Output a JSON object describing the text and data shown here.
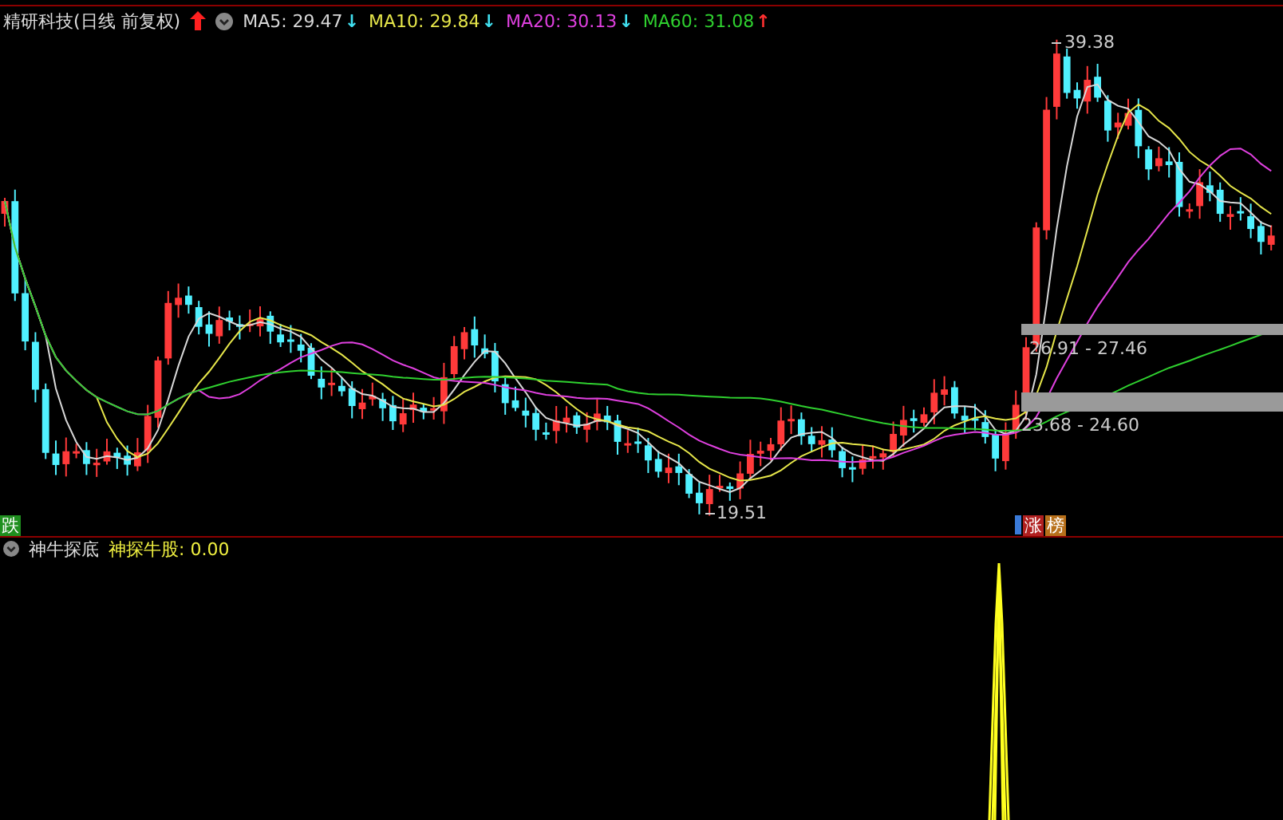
{
  "header": {
    "title": "精研科技(日线 前复权)",
    "moving_averages": [
      {
        "text": "MA5: 29.47",
        "arrow": "↓",
        "kind": "down",
        "color": "#d8d8d8"
      },
      {
        "text": "MA10: 29.84",
        "arrow": "↓",
        "kind": "down",
        "color": "#e6e64a"
      },
      {
        "text": "MA20: 30.13",
        "arrow": "↓",
        "kind": "down",
        "color": "#e040e0"
      },
      {
        "text": "MA60: 31.08",
        "arrow": "↑",
        "kind": "up",
        "color": "#2fd02f"
      }
    ]
  },
  "chart": {
    "high_label": "39.38",
    "low_label": "19.51",
    "zones": [
      {
        "label": "26.91 - 27.46"
      },
      {
        "label": "23.68 - 24.60"
      }
    ],
    "markers": [
      {
        "text": "跌",
        "color": "#1f8f1f",
        "kind": "left"
      },
      {
        "text": "涨",
        "color": "#b02020",
        "kind": "right"
      },
      {
        "text": "榜",
        "color": "#b8701a",
        "kind": "right"
      }
    ]
  },
  "indicator": {
    "name": "神牛探底",
    "reading": "神探牛股: 0.00"
  }
}
